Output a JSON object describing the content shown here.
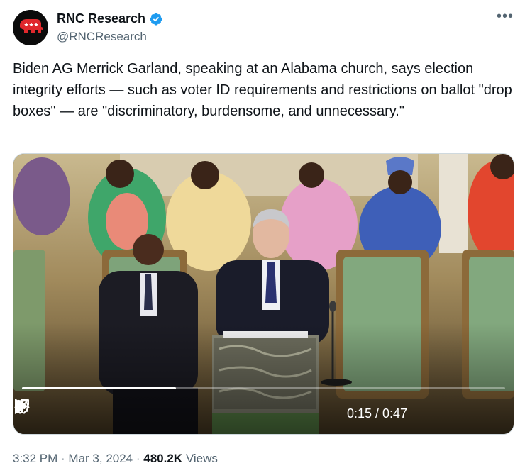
{
  "account": {
    "display_name": "RNC Research",
    "handle": "@RNCResearch",
    "verified": true,
    "avatar_icon": "elephant-logo-icon"
  },
  "menu": {
    "more_label": "•••"
  },
  "tweet": {
    "text": "Biden AG Merrick Garland, speaking at an Alabama church, says election integrity efforts — such as voter ID requirements and restrictions on ballot \"drop boxes\" — are \"discriminatory, burdensome, and unnecessary.\""
  },
  "video": {
    "time_display": "0:15 / 0:47",
    "progress": 0.319,
    "icons": [
      "play-icon",
      "volume-icon",
      "settings-icon",
      "fullscreen-icon"
    ]
  },
  "meta": {
    "time": "3:32 PM",
    "separator": " · ",
    "date": "Mar 3, 2024",
    "views_count": "480.2K",
    "views_label": " Views"
  },
  "colors": {
    "text_primary": "#0f1419",
    "text_secondary": "#536471",
    "verified_blue": "#1d9bf0",
    "rnc_red": "#e0282c"
  }
}
